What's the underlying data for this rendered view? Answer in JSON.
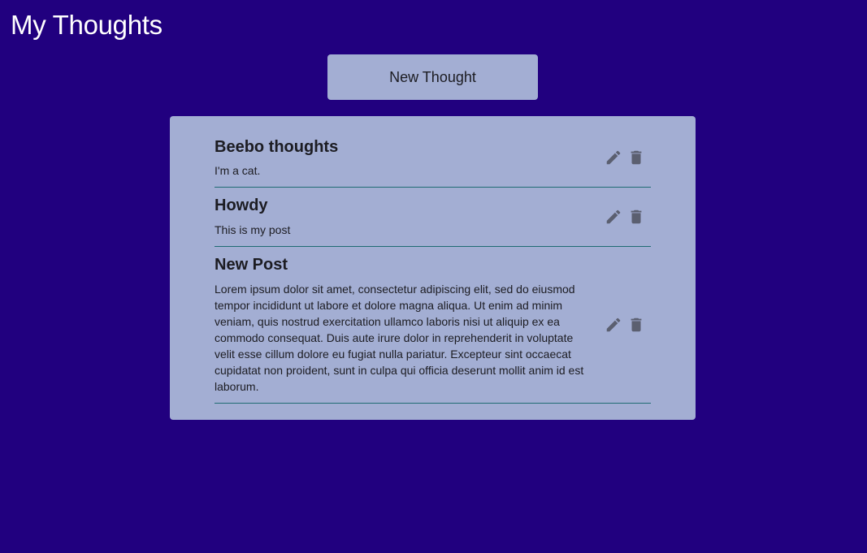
{
  "header": {
    "title": "My Thoughts"
  },
  "toolbar": {
    "new_thought_label": "New Thought"
  },
  "posts": [
    {
      "title": "Beebo thoughts",
      "body": "I'm a cat.",
      "edit_icon": "pencil-icon",
      "delete_icon": "trash-icon"
    },
    {
      "title": "Howdy",
      "body": "This is my post",
      "edit_icon": "pencil-icon",
      "delete_icon": "trash-icon"
    },
    {
      "title": "New Post",
      "body": "Lorem ipsum dolor sit amet, consectetur adipiscing elit, sed do eiusmod tempor incididunt ut labore et dolore magna aliqua. Ut enim ad minim veniam, quis nostrud exercitation ullamco laboris nisi ut aliquip ex ea commodo consequat. Duis aute irure dolor in reprehenderit in voluptate velit esse cillum dolore eu fugiat nulla pariatur. Excepteur sint occaecat cupidatat non proident, sunt in culpa qui officia deserunt mollit anim id est laborum.",
      "edit_icon": "pencil-icon",
      "delete_icon": "trash-icon"
    }
  ],
  "colors": {
    "background": "#21007f",
    "card": "#a3aed3",
    "divider": "#1f6b73",
    "icon": "#5b5f70",
    "text": "#1c1c22"
  }
}
